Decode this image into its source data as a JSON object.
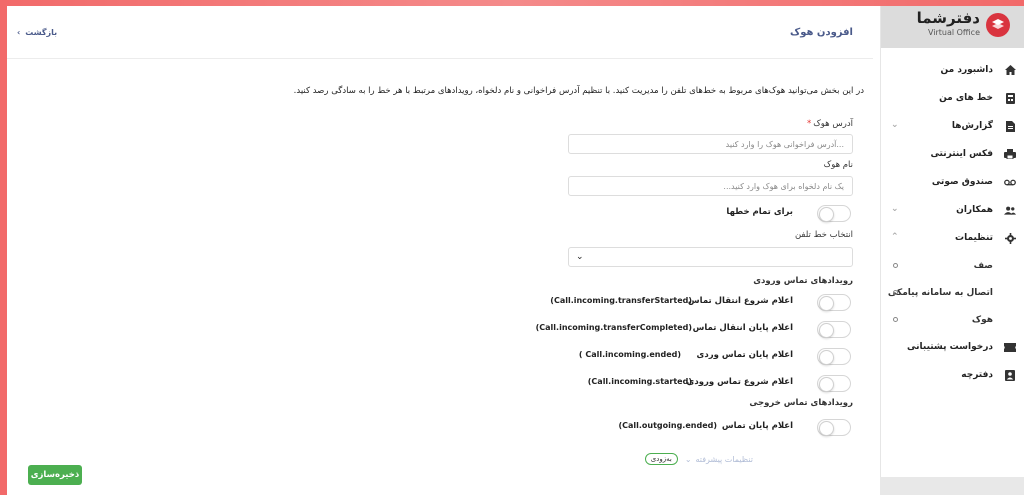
{
  "brand": {
    "name": "دفترشما",
    "subtitle": "Virtual Office",
    "logo_color": "#d9343f"
  },
  "sidebar": {
    "items": [
      {
        "label": "داشبورد من",
        "icon": "home-icon"
      },
      {
        "label": "خط های من",
        "icon": "phone-line-icon"
      },
      {
        "label": "گزارش‌ها",
        "icon": "report-icon",
        "expandable": true
      },
      {
        "label": "فکس اینترنتی",
        "icon": "fax-icon"
      },
      {
        "label": "صندوق صوتی",
        "icon": "voicemail-icon"
      },
      {
        "label": "همکاران",
        "icon": "people-icon",
        "expandable": true
      },
      {
        "label": "تنظیمات",
        "icon": "gear-icon",
        "expanded": true
      }
    ],
    "settings_sub": [
      {
        "label": "صف"
      },
      {
        "label": "اتصال به سامانه پیامکی"
      },
      {
        "label": "هوک"
      }
    ],
    "items_after": [
      {
        "label": "درخواست پشتیبانی",
        "icon": "ticket-icon"
      },
      {
        "label": "دفترچه",
        "icon": "contacts-icon"
      }
    ]
  },
  "header": {
    "title": "افزودن هوک",
    "back_label": "بازگشت"
  },
  "intro": "در این بخش می‌توانید هوک‌های مربوط به خط‌های تلفن را مدیریت کنید. با تنظیم آدرس فراخوانی و نام دلخواه، رویدادهای مرتبط با هر خط را به سادگی رصد کنید.",
  "form": {
    "address_label": "آدرس هوک",
    "address_required": "*",
    "address_placeholder": "...آدرس فراخوانی هوک را وارد کنید",
    "name_label": "نام هوک",
    "name_placeholder": "یک نام دلخواه برای هوک وارد کنید...",
    "all_lines_label": "برای تمام خطها",
    "all_lines_on": false,
    "line_select_label": "انتخاب خط تلفن",
    "line_select_value": "",
    "incoming_title": "رویدادهای تماس ورودی",
    "incoming_events": [
      {
        "label": "اعلام شروع انتقال تماس",
        "code": "(Call.incoming.transferStarted)",
        "on": false
      },
      {
        "label": "اعلام پایان انتقال تماس",
        "code": "(Call.incoming.transferCompleted)",
        "on": false
      },
      {
        "label": "اعلام پایان تماس وردی",
        "code": "( Call.incoming.ended)",
        "on": false
      },
      {
        "label": "اعلام شروع تماس ورودی",
        "code": "(Call.incoming.started)",
        "on": false
      }
    ],
    "outgoing_title": "رویدادهای تماس خروجی",
    "outgoing_events": [
      {
        "label": "اعلام پایان تماس",
        "code": "(Call.outgoing.ended)",
        "on": false
      }
    ],
    "advanced_label": "تنظیمات پیشرفته",
    "advanced_badge": "به‌زودی",
    "save_label": "ذخیره‌سازی"
  },
  "colors": {
    "accent": "#4a5a8a",
    "save": "#4caf50",
    "required": "#e53935"
  }
}
